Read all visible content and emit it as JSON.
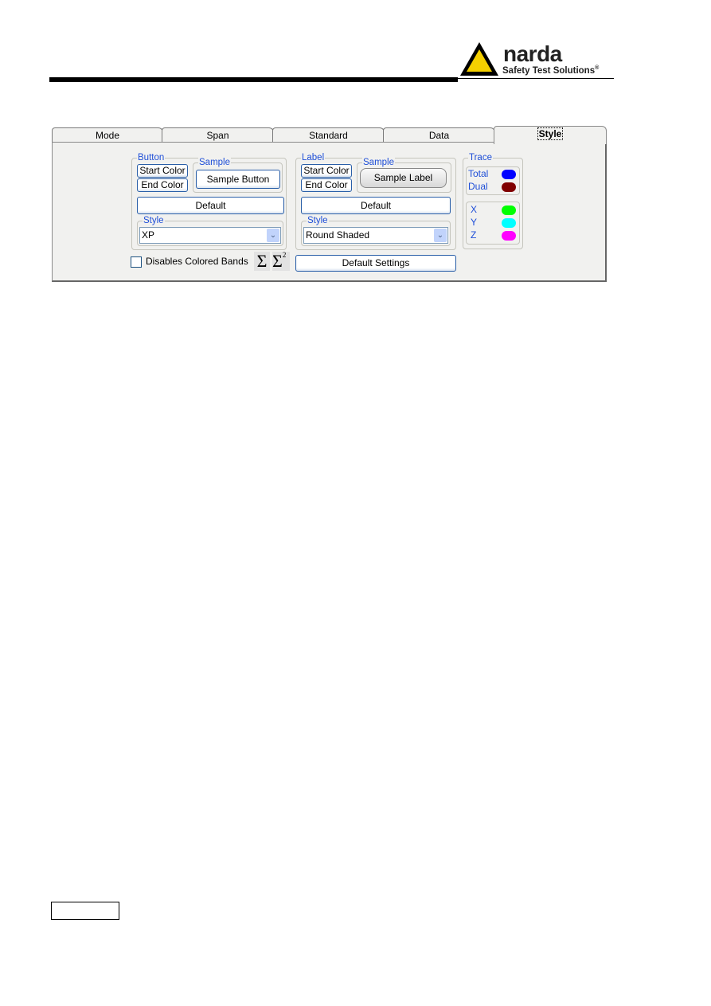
{
  "logo": {
    "brand": "narda",
    "tagline": "Safety Test Solutions",
    "mark": "®"
  },
  "tabs": [
    {
      "label": "Mode"
    },
    {
      "label": "Span"
    },
    {
      "label": "Standard"
    },
    {
      "label": "Data"
    },
    {
      "label": "Style",
      "selected": true
    }
  ],
  "button_group": {
    "title": "Button",
    "start_color": "Start Color",
    "end_color": "End Color",
    "sample_title": "Sample",
    "sample": "Sample Button",
    "default": "Default",
    "style_title": "Style",
    "style_value": "XP"
  },
  "label_group": {
    "title": "Label",
    "start_color": "Start Color",
    "end_color": "End Color",
    "sample_title": "Sample",
    "sample": "Sample Label",
    "default": "Default",
    "style_title": "Style",
    "style_value": "Round Shaded"
  },
  "trace": {
    "title": "Trace",
    "items": [
      {
        "label": "Total",
        "color": "#0000ff"
      },
      {
        "label": "Dual",
        "color": "#800000"
      },
      {
        "label": "X",
        "color": "#00ff00"
      },
      {
        "label": "Y",
        "color": "#00ffff"
      },
      {
        "label": "Z",
        "color": "#ff00ff"
      }
    ]
  },
  "bottom": {
    "checkbox_label": "Disables Colored Bands",
    "checked": false,
    "sigma": "Σ",
    "sigma2": "Σ",
    "sup": "2",
    "default_settings": "Default Settings"
  }
}
